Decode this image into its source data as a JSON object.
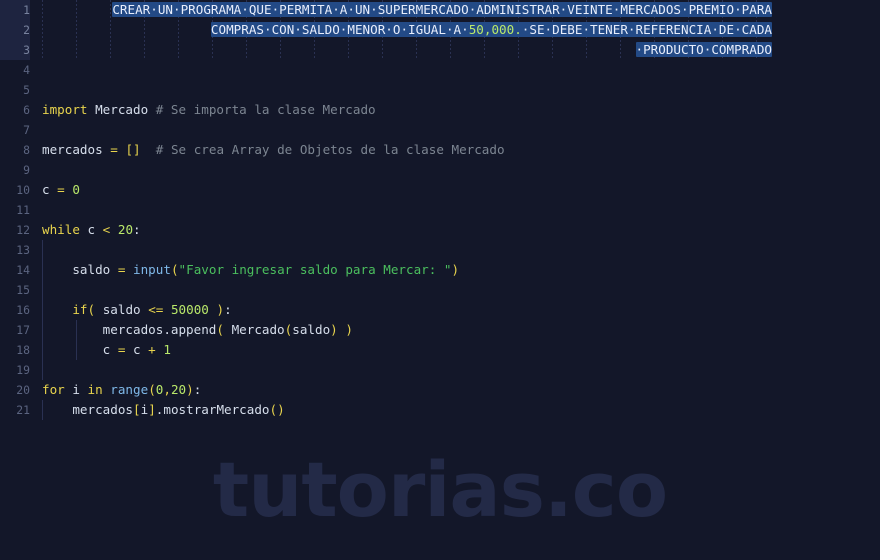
{
  "app": {
    "type": "code-editor",
    "language": "Python",
    "theme": "dark-navy",
    "watermark": "tutorias.co"
  },
  "colors": {
    "background": "#131729",
    "gutter_text": "#5b6480",
    "selection": "#234a86",
    "keyword": "#e8d44d",
    "comment": "#7c8591",
    "number": "#b9e86a",
    "string": "#4bbf5e",
    "function": "#7fb8e8",
    "plain_text": "#d6deeb",
    "watermark": "#232a47"
  },
  "gutter": {
    "line_numbers": [
      "1",
      "2",
      "3",
      "4",
      "5",
      "6",
      "7",
      "8",
      "9",
      "10",
      "11",
      "12",
      "13",
      "14",
      "15",
      "16",
      "17",
      "18",
      "19",
      "20",
      "21"
    ]
  },
  "selection": {
    "active": true,
    "lines": [
      1,
      2,
      3
    ],
    "text": "CREAR UN PROGRAMA QUE PERMITA A UN SUPERMERCADO ADMINISTRAR VEINTE MERCADOS PREMIO PARA COMPRAS CON SALDO MENOR O IGUAL A 50,000. SE DEBE TENER REFERENCIA DE CADA PRODUCTO COMPRADO"
  },
  "lines": [
    {
      "n": "1",
      "text": "                    CREAR·UN·PROGRAMA·QUE·PERMITA·A·UN·SUPERMERCADO·ADMINISTRAR·VEINTE·MERCADOS·PREMIO·PARA"
    },
    {
      "n": "2",
      "text": "                    COMPRAS·CON·SALDO·MENOR·O·IGUAL·A·50,000.·SE·DEBE·TENER·REFERENCIA·DE·CADA"
    },
    {
      "n": "3",
      "text": "                    ·PRODUCTO·COMPRADO"
    },
    {
      "n": "4",
      "text": ""
    },
    {
      "n": "5",
      "text": ""
    },
    {
      "n": "6",
      "text": "import Mercado # Se importa la clase Mercado"
    },
    {
      "n": "7",
      "text": ""
    },
    {
      "n": "8",
      "text": "mercados = []  # Se crea Array de Objetos de la clase Mercado"
    },
    {
      "n": "9",
      "text": ""
    },
    {
      "n": "10",
      "text": "c = 0"
    },
    {
      "n": "11",
      "text": ""
    },
    {
      "n": "12",
      "text": "while c < 20:"
    },
    {
      "n": "13",
      "text": ""
    },
    {
      "n": "14",
      "text": "    saldo = input(\"Favor ingresar saldo para Mercar: \")"
    },
    {
      "n": "15",
      "text": ""
    },
    {
      "n": "16",
      "text": "    if( saldo <= 50000 ):"
    },
    {
      "n": "17",
      "text": "        mercados.append( Mercado(saldo) )"
    },
    {
      "n": "18",
      "text": "        c = c + 1"
    },
    {
      "n": "19",
      "text": ""
    },
    {
      "n": "20",
      "text": "for i in range(0,20):"
    },
    {
      "n": "21",
      "text": "    mercados[i].mostrarMercado()"
    }
  ],
  "tokens": {
    "line1": [
      {
        "t": "CREAR·UN·PROGRAMA·QUE·PERMITA·A·UN·SUPERMERCADO·ADMINISTRAR·VEINTE·MERCADOS·PREMIO·PARA",
        "c": "sel"
      }
    ],
    "line2": [
      {
        "t": "COMPRAS·CON·SALDO·MENOR·O·IGUAL·A·",
        "c": "sel"
      },
      {
        "t": "50,000.",
        "c": "num"
      },
      {
        "t": "·SE·DEBE·TENER·REFERENCIA·DE·CADA",
        "c": "sel"
      }
    ],
    "line3": [
      {
        "t": "·PRODUCTO·COMPRADO",
        "c": "sel"
      }
    ],
    "line6": [
      {
        "t": "import",
        "c": "kw"
      },
      {
        "t": " Mercado ",
        "c": "plain"
      },
      {
        "t": "# Se importa la clase Mercado",
        "c": "cmt"
      }
    ],
    "line8": [
      {
        "t": "mercados ",
        "c": "plain"
      },
      {
        "t": "=",
        "c": "op"
      },
      {
        "t": " ",
        "c": "plain"
      },
      {
        "t": "[]",
        "c": "op"
      },
      {
        "t": "  ",
        "c": "plain"
      },
      {
        "t": "# Se crea Array de Objetos de la clase Mercado",
        "c": "cmt"
      }
    ],
    "line10": [
      {
        "t": "c ",
        "c": "plain"
      },
      {
        "t": "=",
        "c": "op"
      },
      {
        "t": " ",
        "c": "plain"
      },
      {
        "t": "0",
        "c": "num"
      }
    ],
    "line12": [
      {
        "t": "while",
        "c": "kw"
      },
      {
        "t": " c ",
        "c": "plain"
      },
      {
        "t": "<",
        "c": "op"
      },
      {
        "t": " ",
        "c": "plain"
      },
      {
        "t": "20",
        "c": "num"
      },
      {
        "t": ":",
        "c": "plain"
      }
    ],
    "line14": [
      {
        "t": "    saldo ",
        "c": "plain"
      },
      {
        "t": "=",
        "c": "op"
      },
      {
        "t": " ",
        "c": "plain"
      },
      {
        "t": "input",
        "c": "fn"
      },
      {
        "t": "(",
        "c": "op"
      },
      {
        "t": "\"Favor ingresar saldo para Mercar: \"",
        "c": "str"
      },
      {
        "t": ")",
        "c": "op"
      }
    ],
    "line16": [
      {
        "t": "    ",
        "c": "plain"
      },
      {
        "t": "if",
        "c": "kw"
      },
      {
        "t": "(",
        "c": "op"
      },
      {
        "t": " saldo ",
        "c": "plain"
      },
      {
        "t": "<=",
        "c": "op"
      },
      {
        "t": " ",
        "c": "plain"
      },
      {
        "t": "50000",
        "c": "num"
      },
      {
        "t": " ",
        "c": "plain"
      },
      {
        "t": ")",
        "c": "op"
      },
      {
        "t": ":",
        "c": "plain"
      }
    ],
    "line17": [
      {
        "t": "        mercados.append",
        "c": "plain"
      },
      {
        "t": "(",
        "c": "op"
      },
      {
        "t": " Mercado",
        "c": "plain"
      },
      {
        "t": "(",
        "c": "op"
      },
      {
        "t": "saldo",
        "c": "plain"
      },
      {
        "t": ")",
        "c": "op"
      },
      {
        "t": " ",
        "c": "plain"
      },
      {
        "t": ")",
        "c": "op"
      }
    ],
    "line18": [
      {
        "t": "        c ",
        "c": "plain"
      },
      {
        "t": "=",
        "c": "op"
      },
      {
        "t": " c ",
        "c": "plain"
      },
      {
        "t": "+",
        "c": "op"
      },
      {
        "t": " ",
        "c": "plain"
      },
      {
        "t": "1",
        "c": "num"
      }
    ],
    "line20": [
      {
        "t": "for",
        "c": "kw"
      },
      {
        "t": " i ",
        "c": "plain"
      },
      {
        "t": "in",
        "c": "kw"
      },
      {
        "t": " ",
        "c": "plain"
      },
      {
        "t": "range",
        "c": "fn"
      },
      {
        "t": "(",
        "c": "op"
      },
      {
        "t": "0",
        "c": "num"
      },
      {
        "t": ",",
        "c": "op"
      },
      {
        "t": "20",
        "c": "num"
      },
      {
        "t": ")",
        "c": "op"
      },
      {
        "t": ":",
        "c": "plain"
      }
    ],
    "line21": [
      {
        "t": "    mercados",
        "c": "plain"
      },
      {
        "t": "[",
        "c": "op"
      },
      {
        "t": "i",
        "c": "plain"
      },
      {
        "t": "]",
        "c": "op"
      },
      {
        "t": ".mostrarMercado",
        "c": "plain"
      },
      {
        "t": "(",
        "c": "op"
      },
      {
        "t": ")",
        "c": "op"
      }
    ]
  }
}
